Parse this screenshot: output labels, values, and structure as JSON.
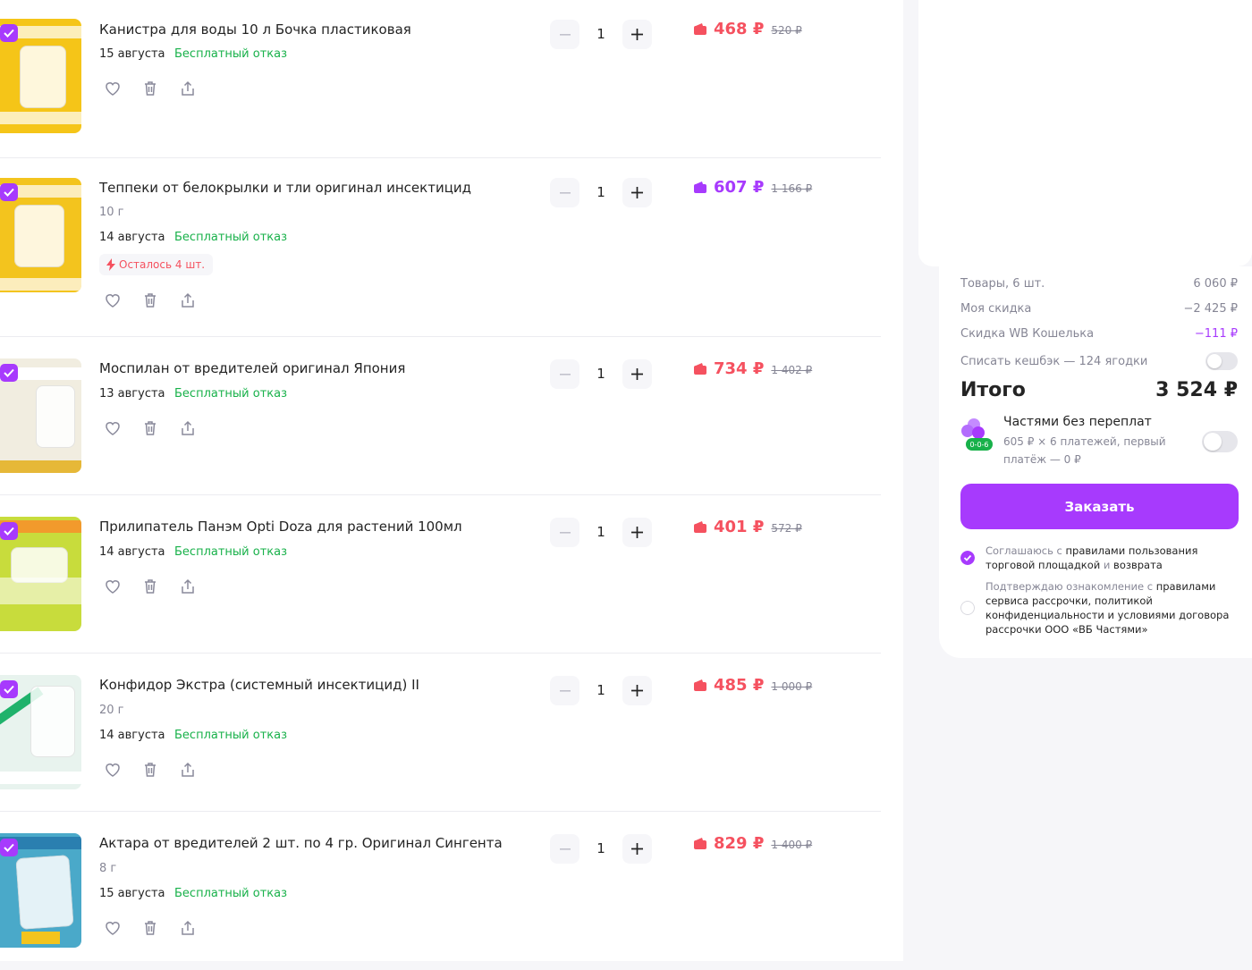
{
  "items": [
    {
      "title": "Канистра для воды 10 л Бочка пластиковая",
      "subtitle": "",
      "date": "15 августа",
      "refund": "Бесплатный отказ",
      "qty": "1",
      "price": "468 ₽",
      "old_price": "520 ₽",
      "price_color": "red",
      "stock": ""
    },
    {
      "title": "Теппеки от белокрылки и тли оригинал инсектицид",
      "subtitle": "10 г",
      "date": "14 августа",
      "refund": "Бесплатный отказ",
      "qty": "1",
      "price": "607 ₽",
      "old_price": "1 166 ₽",
      "price_color": "purple",
      "stock": "Осталось 4 шт."
    },
    {
      "title": "Моспилан от вредителей оригинал Япония",
      "subtitle": "",
      "date": "13 августа",
      "refund": "Бесплатный отказ",
      "qty": "1",
      "price": "734 ₽",
      "old_price": "1 402 ₽",
      "price_color": "red",
      "stock": ""
    },
    {
      "title": "Прилипатель Панэм Opti Doza для растений 100мл",
      "subtitle": "",
      "date": "14 августа",
      "refund": "Бесплатный отказ",
      "qty": "1",
      "price": "401 ₽",
      "old_price": "572 ₽",
      "price_color": "red",
      "stock": ""
    },
    {
      "title": "Конфидор Экстра (системный инсектицид) II",
      "subtitle": "20 г",
      "date": "14 августа",
      "refund": "Бесплатный отказ",
      "qty": "1",
      "price": "485 ₽",
      "old_price": "1 000 ₽",
      "price_color": "red",
      "stock": ""
    },
    {
      "title": "Актара от вредителей 2 шт. по 4 гр. Оригинал Сингента",
      "subtitle": "8 г",
      "date": "15 августа",
      "refund": "Бесплатный отказ",
      "qty": "1",
      "price": "829 ₽",
      "old_price": "1 400 ₽",
      "price_color": "red",
      "stock": ""
    }
  ],
  "summary": {
    "goods_label": "Товары, 6 шт.",
    "goods_value": "6 060 ₽",
    "discount_label": "Моя скидка",
    "discount_value": "−2 425 ₽",
    "wallet_label": "Скидка WB Кошелька",
    "wallet_value": "−111 ₽",
    "cashback_label": "Списать кешбэк — 124 ягодки",
    "total_label": "Итого",
    "total_value": "3 524 ₽",
    "parts_title": "Частями без переплат",
    "parts_sub": "605 ₽ × 6 платежей, первый платёж — 0 ₽",
    "parts_badge": "0-0-6",
    "order_button": "Заказать",
    "agree1_prefix": "Соглашаюсь с",
    "agree1_link1": "правилами пользования торговой площадкой",
    "agree1_mid": "и",
    "agree1_link2": "возврата",
    "agree2_prefix": "Подтверждаю ознакомление с",
    "agree2_link": "правилами сервиса рассрочки, политикой конфиденциальности и условиями договора рассрочки ООО «ВБ Частями»"
  },
  "colors": {
    "accent": "#a73afd",
    "price_red": "#f5515f",
    "green": "#18b14a",
    "thumb_bg": [
      "#f5c518",
      "#f3c41e",
      "#f1ede0",
      "#c8dc3c",
      "#e8f3ee",
      "#4aa9c9"
    ]
  }
}
